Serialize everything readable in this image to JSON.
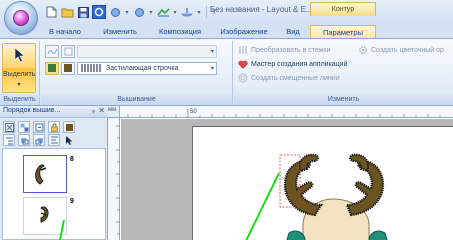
{
  "window": {
    "title": "Без названия - Layout & E...",
    "contextual_group": "Контур"
  },
  "tabs": [
    {
      "label": "В начало"
    },
    {
      "label": "Изменить"
    },
    {
      "label": "Композиция"
    },
    {
      "label": "Изображение"
    },
    {
      "label": "Вид"
    },
    {
      "label": "Параметры",
      "active": true
    }
  ],
  "ribbon": {
    "select_group": {
      "button_label": "Выделить",
      "group_label": "Выделить"
    },
    "stitch_group": {
      "group_label": "Вышивание",
      "fill_stitch_value": "Застилающая строчка"
    },
    "change_group": {
      "group_label": "Изменить",
      "convert_to_stitch": "Преобразовать в стежки",
      "create_color_order": "Создать цветочный ор",
      "applique_wizard": "Мастер создания аппликаций",
      "create_offset_lines": "Создать смещенные линии"
    }
  },
  "panel": {
    "title": "Порядок вышив...",
    "pin": "ᵩ",
    "close": "✕",
    "items": [
      {
        "number": "8",
        "selected": true
      },
      {
        "number": "9",
        "selected": false
      }
    ]
  },
  "ruler": {
    "unit": "мм",
    "marks": [
      "50",
      "100"
    ]
  },
  "colors": {
    "ribbon_bg": "#dfe9f6",
    "accent": "#15428b",
    "selection_yellow": "#ffc23b",
    "antler_brown": "#6b5420",
    "antler_outline": "#1a1a1a",
    "green_marker": "#00e000",
    "face_cream": "#f3e3c0",
    "teal_body": "#1f8f78"
  }
}
